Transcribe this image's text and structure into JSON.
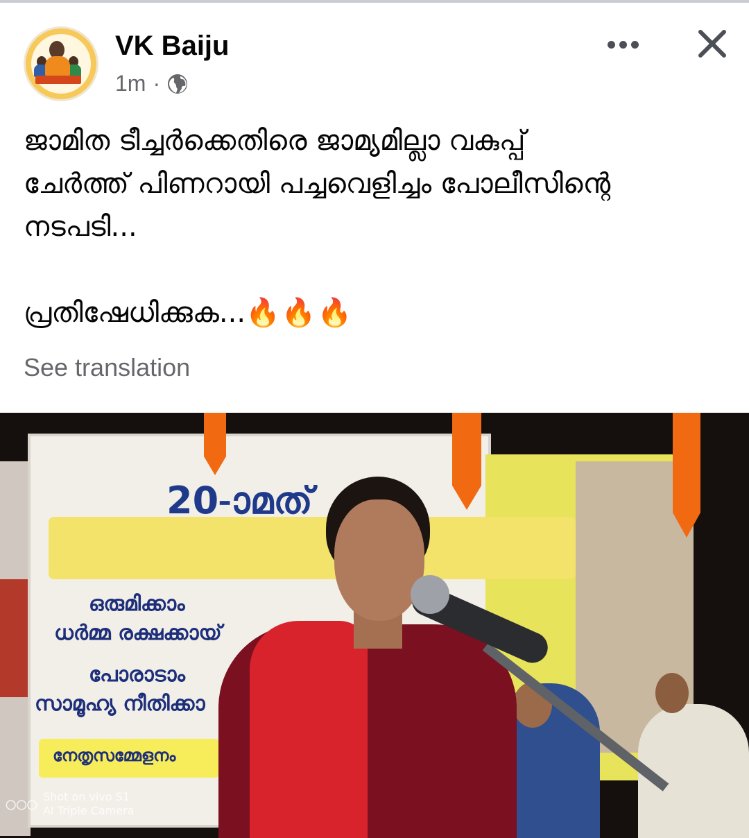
{
  "post": {
    "author": "VK Baiju",
    "time": "1m",
    "separator": "·",
    "privacy_icon": "globe-icon",
    "text": "ജാമിത ടീച്ചർക്കെതിരെ ജാമ്യമില്ലാ വകുപ്പ്\nചേർത്ത് പിണറായി പച്ചവെളിച്ചം പോലീസിന്റെ\nനടപടി...\n\nപ്രതിഷേധിക്കുക...",
    "emoji": "🔥🔥🔥",
    "see_translation": "See translation",
    "more_icon": "more-horizontal-icon",
    "close_icon": "close-icon"
  },
  "photo": {
    "banner": {
      "number": "20-ാമത്",
      "line1": "ഒരുമിക്കാം",
      "line2": "ധർമ്മ രക്ഷക്കായ്",
      "line3": "പോരാടാം",
      "line4": "സാമൂഹ്യ നീതിക്കാ",
      "badge": "നേതൃസമ്മേളനം"
    },
    "watermark_line1": "Shot on vivo S1",
    "watermark_line2": "AI Triple Camera"
  },
  "colors": {
    "meta_gray": "#65676b",
    "flag_orange": "#f16a12",
    "banner_blue": "#1d2f7a"
  }
}
